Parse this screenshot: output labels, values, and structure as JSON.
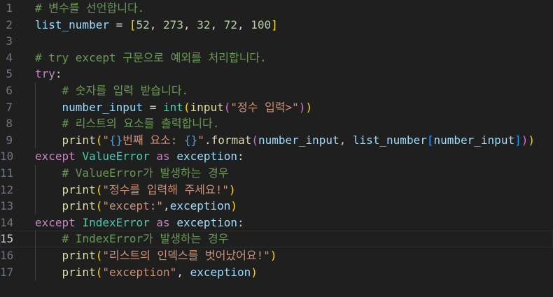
{
  "editor": {
    "active_line": 15,
    "lines": [
      {
        "n": "1",
        "indent": "",
        "tokens": [
          {
            "t": "# 변수를 선언합니다.",
            "c": "cm"
          }
        ]
      },
      {
        "n": "2",
        "indent": "",
        "tokens": [
          {
            "t": "list_number",
            "c": "var"
          },
          {
            "t": " = ",
            "c": "p"
          },
          {
            "t": "[",
            "c": "b1"
          },
          {
            "t": "52",
            "c": "num"
          },
          {
            "t": ", ",
            "c": "p"
          },
          {
            "t": "273",
            "c": "num"
          },
          {
            "t": ", ",
            "c": "p"
          },
          {
            "t": "32",
            "c": "num"
          },
          {
            "t": ", ",
            "c": "p"
          },
          {
            "t": "72",
            "c": "num"
          },
          {
            "t": ", ",
            "c": "p"
          },
          {
            "t": "100",
            "c": "num"
          },
          {
            "t": "]",
            "c": "b1"
          }
        ]
      },
      {
        "n": "3",
        "indent": "",
        "tokens": []
      },
      {
        "n": "4",
        "indent": "",
        "tokens": [
          {
            "t": "# try except 구문으로 예외를 처리합니다.",
            "c": "cm"
          }
        ]
      },
      {
        "n": "5",
        "indent": "",
        "tokens": [
          {
            "t": "try",
            "c": "kw"
          },
          {
            "t": ":",
            "c": "p"
          }
        ]
      },
      {
        "n": "6",
        "indent": "    ",
        "tokens": [
          {
            "t": "# 숫자를 입력 받습니다.",
            "c": "cm"
          }
        ]
      },
      {
        "n": "7",
        "indent": "    ",
        "tokens": [
          {
            "t": "number_input",
            "c": "var"
          },
          {
            "t": " = ",
            "c": "p"
          },
          {
            "t": "int",
            "c": "cls"
          },
          {
            "t": "(",
            "c": "b1"
          },
          {
            "t": "input",
            "c": "fn"
          },
          {
            "t": "(",
            "c": "b2"
          },
          {
            "t": "\"정수 입력>\"",
            "c": "str"
          },
          {
            "t": ")",
            "c": "b2"
          },
          {
            "t": ")",
            "c": "b1"
          }
        ]
      },
      {
        "n": "8",
        "indent": "    ",
        "tokens": [
          {
            "t": "# 리스트의 요소를 출력합니다.",
            "c": "cm"
          }
        ]
      },
      {
        "n": "9",
        "indent": "    ",
        "tokens": [
          {
            "t": "print",
            "c": "fn"
          },
          {
            "t": "(",
            "c": "b1"
          },
          {
            "t": "\"",
            "c": "str"
          },
          {
            "t": "{}",
            "c": "esc"
          },
          {
            "t": "번째 요소: ",
            "c": "str"
          },
          {
            "t": "{}",
            "c": "esc"
          },
          {
            "t": "\"",
            "c": "str"
          },
          {
            "t": ".",
            "c": "p"
          },
          {
            "t": "format",
            "c": "fn"
          },
          {
            "t": "(",
            "c": "b2"
          },
          {
            "t": "number_input",
            "c": "var"
          },
          {
            "t": ", ",
            "c": "p"
          },
          {
            "t": "list_number",
            "c": "var"
          },
          {
            "t": "[",
            "c": "b3"
          },
          {
            "t": "number_input",
            "c": "var"
          },
          {
            "t": "]",
            "c": "b3"
          },
          {
            "t": ")",
            "c": "b2"
          },
          {
            "t": ")",
            "c": "b1"
          }
        ]
      },
      {
        "n": "10",
        "indent": "",
        "tokens": [
          {
            "t": "except",
            "c": "kw"
          },
          {
            "t": " ",
            "c": "p"
          },
          {
            "t": "ValueError",
            "c": "cls"
          },
          {
            "t": " ",
            "c": "p"
          },
          {
            "t": "as",
            "c": "kw"
          },
          {
            "t": " ",
            "c": "p"
          },
          {
            "t": "exception",
            "c": "var"
          },
          {
            "t": ":",
            "c": "p"
          }
        ]
      },
      {
        "n": "11",
        "indent": "    ",
        "tokens": [
          {
            "t": "# ValueError가 발생하는 경우",
            "c": "cm"
          }
        ]
      },
      {
        "n": "12",
        "indent": "    ",
        "tokens": [
          {
            "t": "print",
            "c": "fn"
          },
          {
            "t": "(",
            "c": "b1"
          },
          {
            "t": "\"정수를 입력해 주세요!\"",
            "c": "str"
          },
          {
            "t": ")",
            "c": "b1"
          }
        ]
      },
      {
        "n": "13",
        "indent": "    ",
        "tokens": [
          {
            "t": "print",
            "c": "fn"
          },
          {
            "t": "(",
            "c": "b1"
          },
          {
            "t": "\"except:\"",
            "c": "str"
          },
          {
            "t": ",",
            "c": "p"
          },
          {
            "t": "exception",
            "c": "var"
          },
          {
            "t": ")",
            "c": "b1"
          }
        ]
      },
      {
        "n": "14",
        "indent": "",
        "tokens": [
          {
            "t": "except",
            "c": "kw"
          },
          {
            "t": " ",
            "c": "p"
          },
          {
            "t": "IndexError",
            "c": "cls"
          },
          {
            "t": " ",
            "c": "p"
          },
          {
            "t": "as",
            "c": "kw"
          },
          {
            "t": " ",
            "c": "p"
          },
          {
            "t": "exception",
            "c": "var"
          },
          {
            "t": ":",
            "c": "p"
          }
        ]
      },
      {
        "n": "15",
        "indent": "    ",
        "tokens": [
          {
            "t": "# IndexError가 발생하는 경우",
            "c": "cm"
          }
        ]
      },
      {
        "n": "16",
        "indent": "    ",
        "tokens": [
          {
            "t": "print",
            "c": "fn"
          },
          {
            "t": "(",
            "c": "b1"
          },
          {
            "t": "\"리스트의 인덱스를 벗어났어요!\"",
            "c": "str"
          },
          {
            "t": ")",
            "c": "b1"
          }
        ]
      },
      {
        "n": "17",
        "indent": "    ",
        "tokens": [
          {
            "t": "print",
            "c": "fn"
          },
          {
            "t": "(",
            "c": "b1"
          },
          {
            "t": "\"exception\"",
            "c": "str"
          },
          {
            "t": ", ",
            "c": "p"
          },
          {
            "t": "exception",
            "c": "var"
          },
          {
            "t": ")",
            "c": "b1"
          }
        ]
      }
    ]
  }
}
